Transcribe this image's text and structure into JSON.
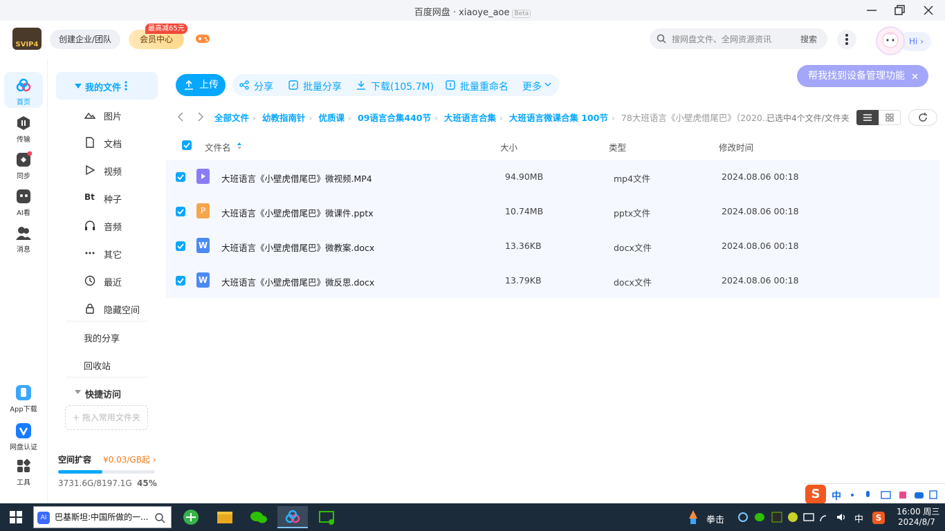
{
  "window": {
    "title": "百度网盘 · xiaoye_aoe",
    "beta": "Beta"
  },
  "header": {
    "logo_text": "SVIP4",
    "create_team": "创建企业/团队",
    "vip_center": "会员中心",
    "vip_badge": "最高减65元",
    "search_placeholder": "搜网盘文件、全网资源资讯",
    "search_button": "搜索",
    "hi": "Hi"
  },
  "rail": [
    {
      "label": "首页",
      "icon": "home-icon"
    },
    {
      "label": "传输",
      "icon": "transfer-icon"
    },
    {
      "label": "同步",
      "icon": "sync-icon"
    },
    {
      "label": "AI看",
      "icon": "ai-icon"
    },
    {
      "label": "消息",
      "icon": "message-icon"
    }
  ],
  "rail_bottom": [
    {
      "label": "App下载",
      "icon": "phone-icon"
    },
    {
      "label": "网盘认证",
      "icon": "verify-icon"
    },
    {
      "label": "工具",
      "icon": "tools-icon"
    }
  ],
  "sidebar": {
    "my_files": "我的文件",
    "categories": [
      "图片",
      "文档",
      "视频",
      "种子",
      "音频",
      "其它",
      "最近",
      "隐藏空间"
    ],
    "torrent_glyph": "Bt",
    "my_share": "我的分享",
    "recycle": "回收站",
    "quick_access": "快捷访问",
    "drop_hint": "+ 拖入常用文件夹",
    "quota_title": "空间扩容",
    "quota_price": "¥0.03/GB起",
    "quota_used": "3731.6G/8197.1G",
    "quota_percent": "45%",
    "quota_fraction": 0.455
  },
  "toolbar": {
    "upload": "上传",
    "share": "分享",
    "batch_share": "批量分享",
    "download": "下载(105.7M)",
    "batch_rename": "批量重命名",
    "more": "更多",
    "tip": "帮我找到设备管理功能"
  },
  "breadcrumb": [
    "全部文件",
    "幼教指南针",
    "优质课",
    "09语言合集440节",
    "大班语言合集",
    "大班语言微课合集 100节",
    "78大班语言《小壁虎借尾巴》（2020..."
  ],
  "selection": "已选中4个文件/文件夹",
  "columns": {
    "name": "文件名",
    "size": "大小",
    "type": "类型",
    "modified": "修改时间"
  },
  "files": [
    {
      "name": "大班语言《小壁虎借尾巴》微视频.MP4",
      "size": "94.90MB",
      "type": "mp4文件",
      "modified": "2024.08.06 00:18",
      "icon_color": "#8b7cf6",
      "icon_letter": "▶"
    },
    {
      "name": "大班语言《小壁虎借尾巴》微课件.pptx",
      "size": "10.74MB",
      "type": "pptx文件",
      "modified": "2024.08.06 00:18",
      "icon_color": "#f7a54a",
      "icon_letter": "P"
    },
    {
      "name": "大班语言《小壁虎借尾巴》微教案.docx",
      "size": "13.36KB",
      "type": "docx文件",
      "modified": "2024.08.06 00:18",
      "icon_color": "#4a8af4",
      "icon_letter": "W"
    },
    {
      "name": "大班语言《小壁虎借尾巴》微反思.docx",
      "size": "13.79KB",
      "type": "docx文件",
      "modified": "2024.08.06 00:18",
      "icon_color": "#4a8af4",
      "icon_letter": "W"
    }
  ],
  "taskbar": {
    "search_text": "巴基斯坦:中国所做的一...",
    "weather_text": "拳击",
    "ime": "中",
    "time": "16:00 周三",
    "date": "2024/8/7"
  },
  "colors": {
    "accent": "#06a7ff",
    "tip": "#a4a6f9",
    "taskbar": "#1c2b3a"
  }
}
